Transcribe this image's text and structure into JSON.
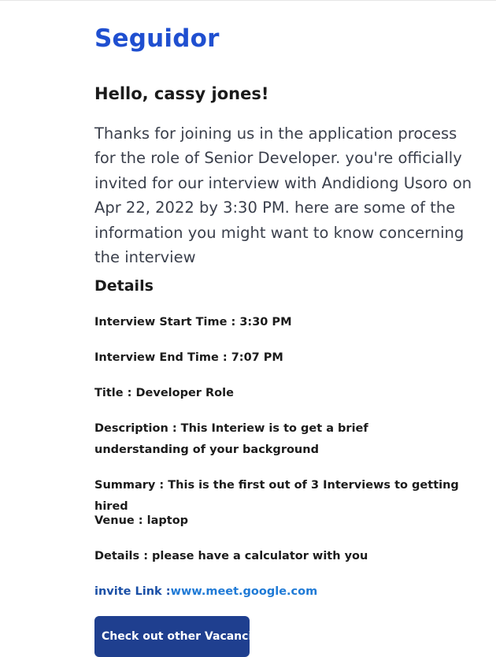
{
  "brand": {
    "name": "Seguidor"
  },
  "email": {
    "greeting": "Hello, cassy jones!",
    "intro": "Thanks for joining us in the application process for the role of Senior Developer. you're officially invited for our interview with Andidiong Usoro on Apr 22, 2022 by 3:30 PM. here are some of the information you might want to know concerning the interview",
    "details_title": "Details",
    "details": {
      "start": "Interview Start Time : 3:30 PM",
      "end": "Interview End Time : 7:07 PM",
      "title": "Title : Developer Role",
      "description": "Description : This Interiew is to get a brief understanding of your background",
      "summary": "Summary : This is the first out of 3 Interviews to getting hired",
      "venue": "Venue : laptop",
      "extra": "Details : please have a calculator with you"
    },
    "invite": {
      "label": "invite Link :",
      "link_text": "www.meet.google.com"
    },
    "cta_label": "Check out other Vacancies"
  },
  "colors": {
    "brand": "#1f4fd0",
    "button_bg": "#1f3f8f",
    "link": "#1f7ad6",
    "body_text": "#3a3f4b"
  }
}
